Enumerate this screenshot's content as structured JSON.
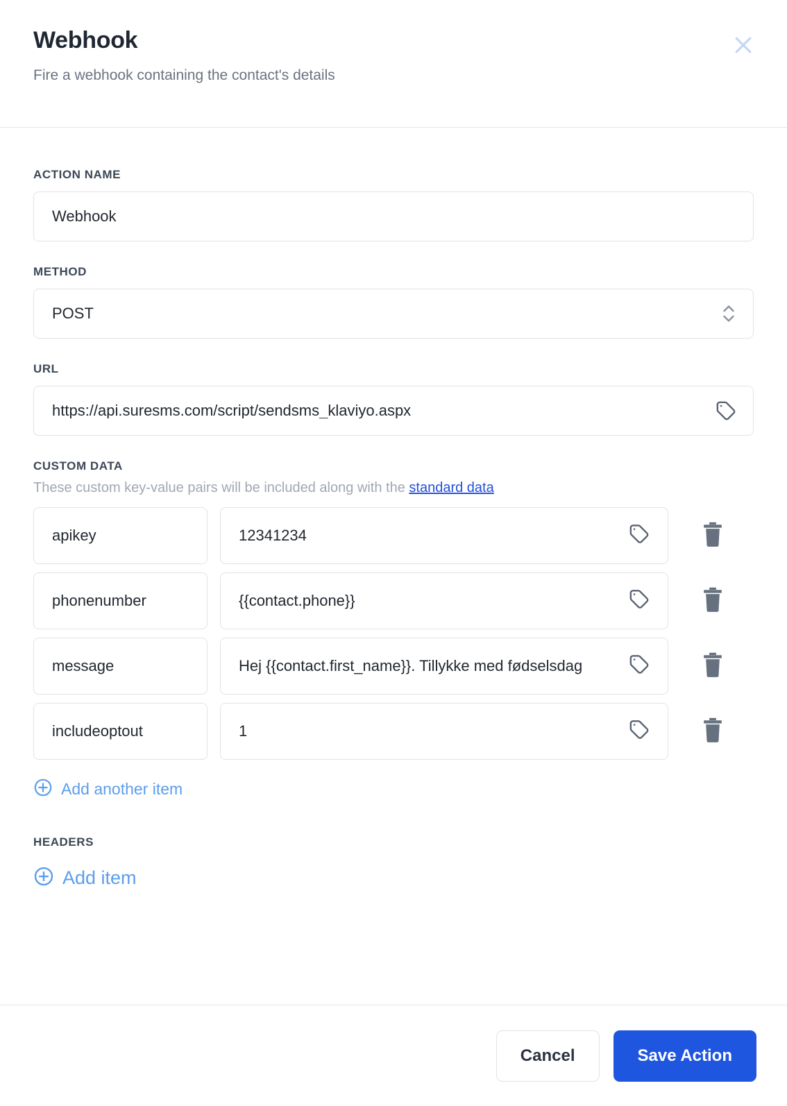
{
  "header": {
    "title": "Webhook",
    "subtitle": "Fire a webhook containing the contact's details",
    "close_icon": "close-icon"
  },
  "form": {
    "action_name": {
      "label": "ACTION NAME",
      "value": "Webhook"
    },
    "method": {
      "label": "METHOD",
      "value": "POST",
      "icon": "chevron-up-down-icon"
    },
    "url": {
      "label": "URL",
      "value": "https://api.suresms.com/script/sendsms_klaviyo.aspx",
      "icon": "tag-icon"
    }
  },
  "custom_data": {
    "label": "CUSTOM DATA",
    "help_prefix": "These custom key-value pairs will be included along with the ",
    "help_link": "standard data",
    "rows": [
      {
        "key": "apikey",
        "value": "12341234",
        "icon": "tag-icon",
        "delete_icon": "trash-icon"
      },
      {
        "key": "phonenumber",
        "value": "{{contact.phone}}",
        "icon": "tag-icon",
        "delete_icon": "trash-icon"
      },
      {
        "key": "message",
        "value": "Hej {{contact.first_name}}. Tillykke med fødselsdag",
        "icon": "tag-icon",
        "delete_icon": "trash-icon"
      },
      {
        "key": "includeoptout",
        "value": "1",
        "icon": "tag-icon",
        "delete_icon": "trash-icon"
      }
    ],
    "add_label": "Add another item",
    "add_icon": "plus-circle-icon"
  },
  "headers": {
    "label": "HEADERS",
    "add_label": "Add item",
    "add_icon": "plus-circle-icon"
  },
  "footer": {
    "cancel_label": "Cancel",
    "save_label": "Save Action"
  },
  "colors": {
    "primary": "#1f56e0",
    "link": "#5c9ded",
    "text": "#21272f",
    "muted": "#a0a7b4",
    "border": "#dfe3e9",
    "close": "#c7d5f7"
  }
}
